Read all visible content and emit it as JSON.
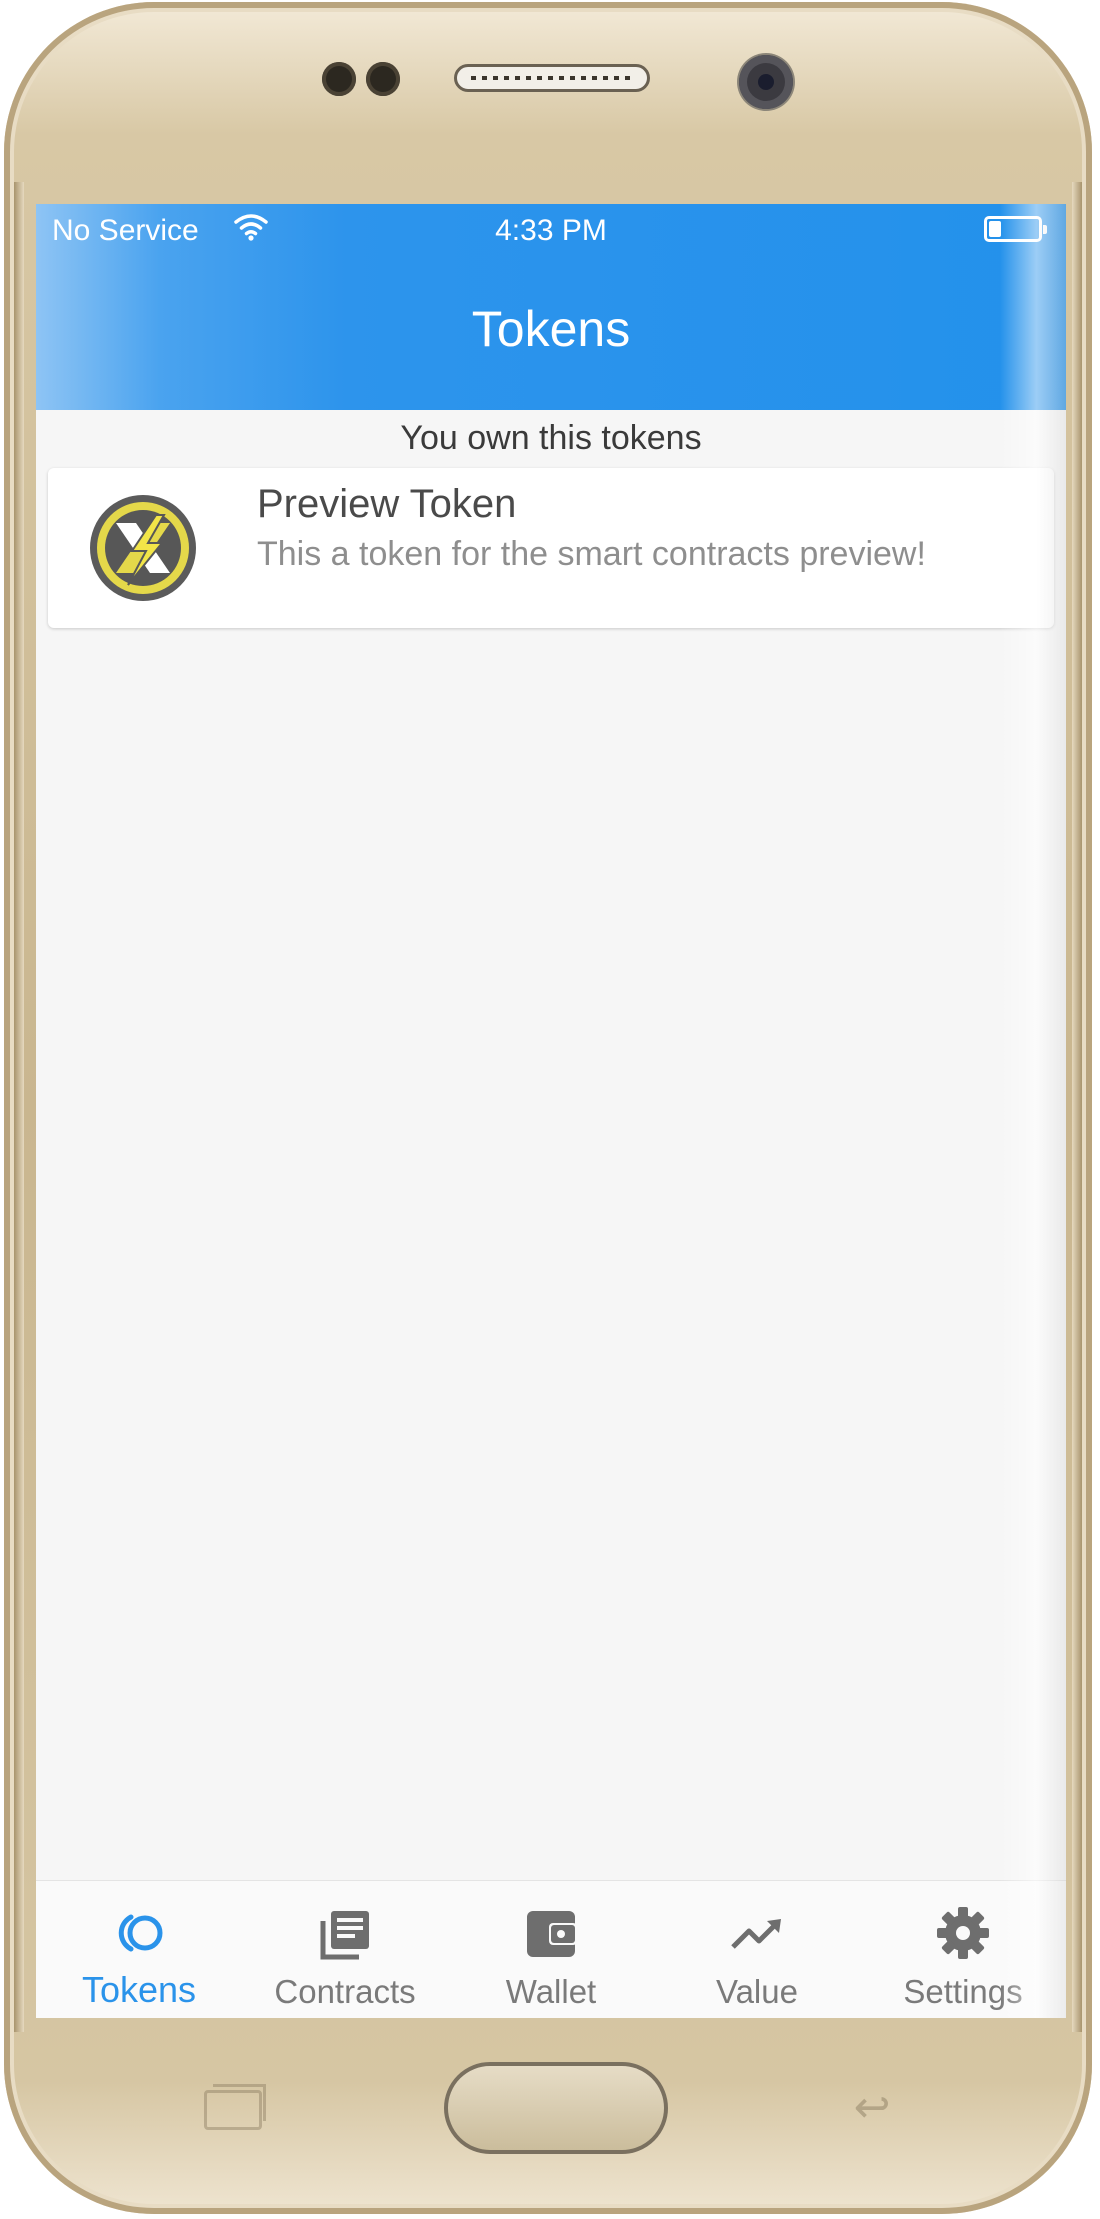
{
  "status_bar": {
    "carrier": "No Service",
    "time": "4:33 PM"
  },
  "header": {
    "title": "Tokens"
  },
  "main": {
    "section_label": "You own this tokens",
    "tokens": [
      {
        "name": "Preview Token",
        "description": "This a token for the smart contracts preview!",
        "icon": "lightning-x-coin-icon"
      }
    ]
  },
  "tabbar": {
    "active": "Tokens",
    "tabs": [
      {
        "label": "Tokens",
        "icon": "tokens-icon"
      },
      {
        "label": "Contracts",
        "icon": "contracts-icon"
      },
      {
        "label": "Wallet",
        "icon": "wallet-icon"
      },
      {
        "label": "Value",
        "icon": "trending-up-icon"
      },
      {
        "label": "Settings",
        "icon": "gear-icon"
      }
    ]
  },
  "colors": {
    "accent": "#2391eb",
    "header_bg": "#2391eb",
    "tab_inactive": "#7a7a7a",
    "background": "#f6f6f6"
  }
}
